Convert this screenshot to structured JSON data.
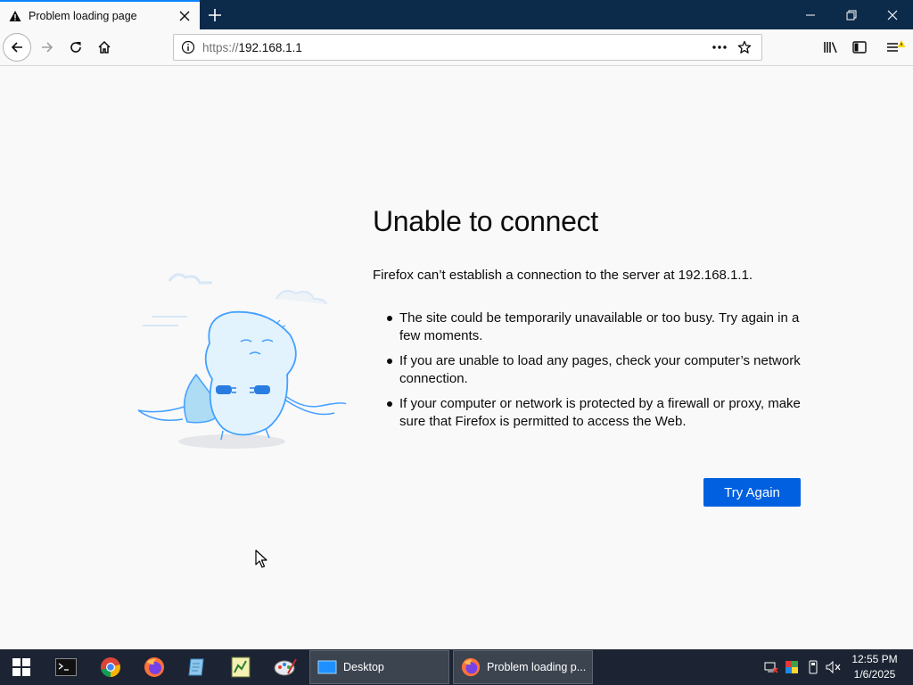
{
  "browser": {
    "tab_title": "Problem loading page",
    "url_scheme": "https://",
    "url_host": "192.168.1.1"
  },
  "error": {
    "heading": "Unable to connect",
    "description": "Firefox can’t establish a connection to the server at 192.168.1.1.",
    "bullets": [
      "The site could be temporarily unavailable or too busy. Try again in a few moments.",
      "If you are unable to load any pages, check your computer’s network connection.",
      "If your computer or network is protected by a firewall or proxy, make sure that Firefox is permitted to access the Web."
    ],
    "try_again_label": "Try Again"
  },
  "taskbar": {
    "tasks": [
      {
        "label": "Desktop",
        "icon": "desktop-icon"
      },
      {
        "label": "Problem loading p...",
        "icon": "firefox-icon"
      }
    ],
    "clock_time": "12:55 PM",
    "clock_date": "1/6/2025"
  },
  "colors": {
    "accent": "#0a84ff",
    "button": "#0060df",
    "taskbar": "#1c2433",
    "tab_strip": "#0c2a4a"
  }
}
